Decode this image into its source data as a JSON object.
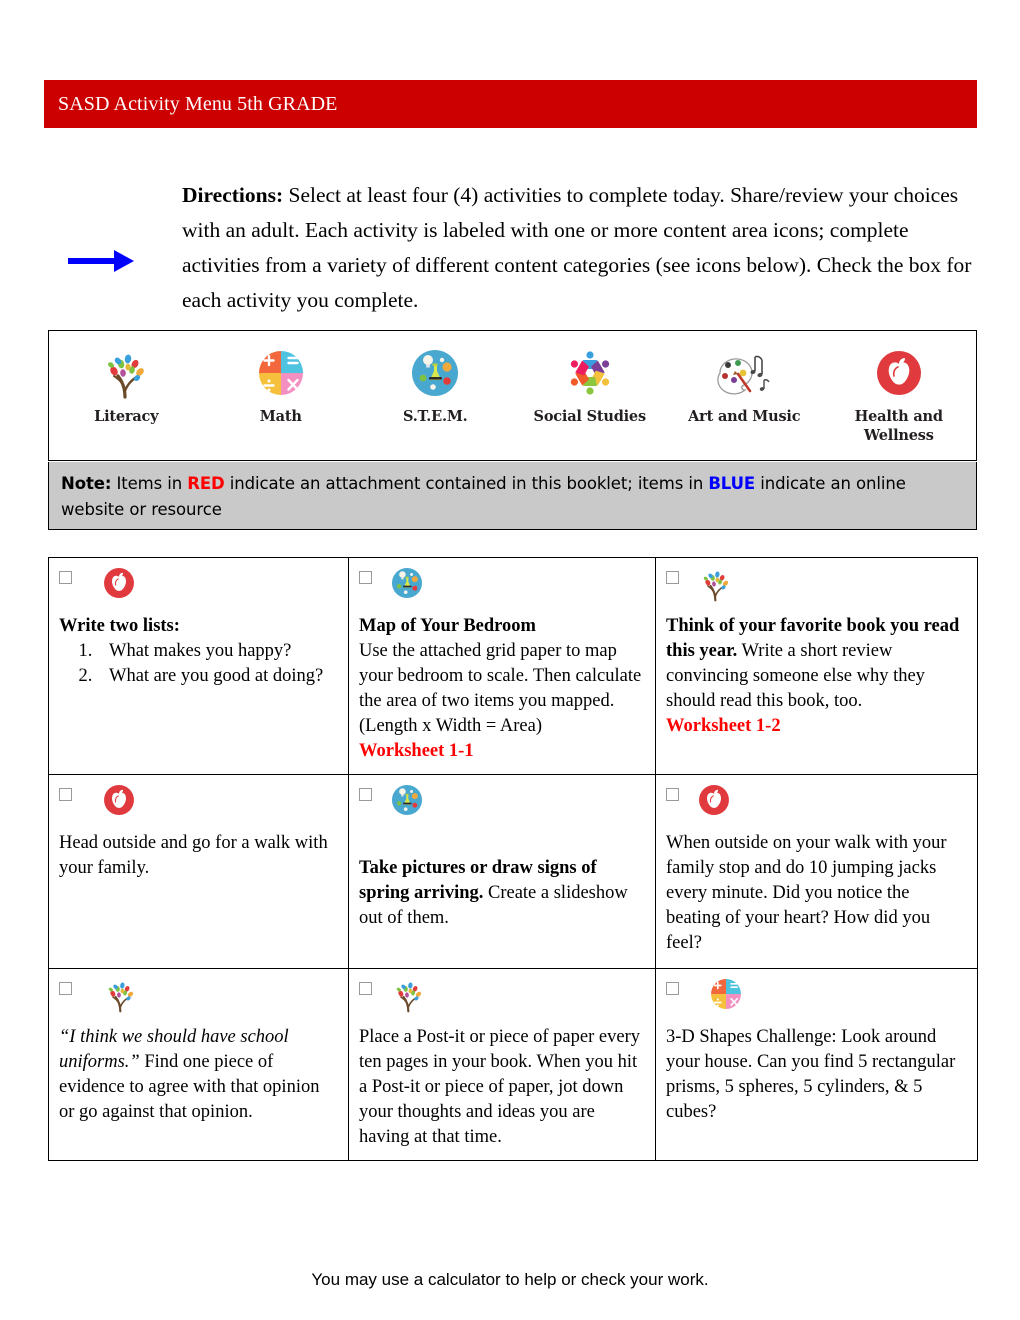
{
  "header": {
    "title": "SASD Activity Menu 5th GRADE",
    "bar_color": "#CC0000"
  },
  "directions": {
    "label": "Directions:",
    "body": " Select at least four (4) activities to complete today. Share/review your choices with an adult. Each activity is labeled with one or more content area icons; complete activities from a variety of different content categories (see icons below). Check the box for each activity you complete.",
    "arrow_icon": "right-arrow-icon",
    "arrow_color": "#0000FF"
  },
  "legend": {
    "items": [
      {
        "label": "Literacy",
        "icon": "literacy-tree-icon"
      },
      {
        "label": "Math",
        "icon": "math-operations-circle-icon"
      },
      {
        "label": "S.T.E.M.",
        "icon": "stem-science-circle-icon"
      },
      {
        "label": "Social Studies",
        "icon": "social-studies-people-ring-icon"
      },
      {
        "label": "Art and Music",
        "icon": "art-music-palette-icon"
      },
      {
        "label": "Health and Wellness",
        "icon": "health-wellness-apple-icon"
      }
    ]
  },
  "note": {
    "label": "Note:",
    "part1": " Items in ",
    "red_word": "RED",
    "part2": " indicate an attachment contained in this booklet; items in ",
    "blue_word": "BLUE",
    "part3": " indicate an online website or resource",
    "red_color": "#FF0000",
    "blue_color": "#0000FF",
    "background": "#c9c9c9"
  },
  "activities": {
    "rows": [
      [
        {
          "checkbox_checked": false,
          "icon": "health-wellness-apple-icon",
          "heading": "Write two lists:",
          "list": [
            "What makes you happy?",
            "What are you good at doing?"
          ],
          "body": "",
          "worksheet": ""
        },
        {
          "checkbox_checked": false,
          "icon": "stem-science-circle-icon",
          "heading": "Map of Your Bedroom",
          "list": [],
          "body": "Use the attached grid paper to map your bedroom to scale.  Then calculate the area of two items you mapped.  (Length x Width = Area)",
          "worksheet": "Worksheet 1-1"
        },
        {
          "checkbox_checked": false,
          "icon": "literacy-tree-icon",
          "heading": "Think of your favorite book you read this year.",
          "list": [],
          "body": "  Write a short review convincing someone else why they should read this book, too.",
          "worksheet": "Worksheet 1-2"
        }
      ],
      [
        {
          "checkbox_checked": false,
          "icon": "health-wellness-apple-icon",
          "heading": "",
          "list": [],
          "body": "Head outside and go for a walk with your family.",
          "worksheet": ""
        },
        {
          "checkbox_checked": false,
          "icon": "stem-science-circle-icon",
          "heading": "Take pictures or draw signs of spring arriving.",
          "list": [],
          "body": " Create a slideshow out of them.",
          "worksheet": "",
          "leading_blank_line": true
        },
        {
          "checkbox_checked": false,
          "icon": "health-wellness-apple-icon",
          "heading": "",
          "list": [],
          "body": "When outside on your walk with your family stop and do 10 jumping jacks every minute. Did you notice the beating of your heart? How did you feel?",
          "worksheet": ""
        }
      ],
      [
        {
          "checkbox_checked": false,
          "icon": "literacy-tree-icon",
          "quote": "“I think we should have school uniforms.”",
          "heading": "",
          "list": [],
          "body": " Find one piece of evidence to agree with that opinion or go against that opinion.",
          "worksheet": ""
        },
        {
          "checkbox_checked": false,
          "icon": "literacy-tree-icon",
          "heading": "",
          "list": [],
          "body": "Place a Post-it or piece of paper every ten pages in your book. When you hit a Post-it or piece of paper, jot down your thoughts and ideas you are having at that time.",
          "worksheet": ""
        },
        {
          "checkbox_checked": false,
          "icon": "math-operations-circle-icon",
          "heading": "",
          "list": [],
          "body": "3-D Shapes Challenge:  Look around your house.  Can you find 5 rectangular prisms, 5 spheres, 5 cylinders, & 5 cubes?",
          "worksheet": ""
        }
      ]
    ]
  },
  "footer": {
    "text": "You may use a calculator to help or check your work."
  }
}
